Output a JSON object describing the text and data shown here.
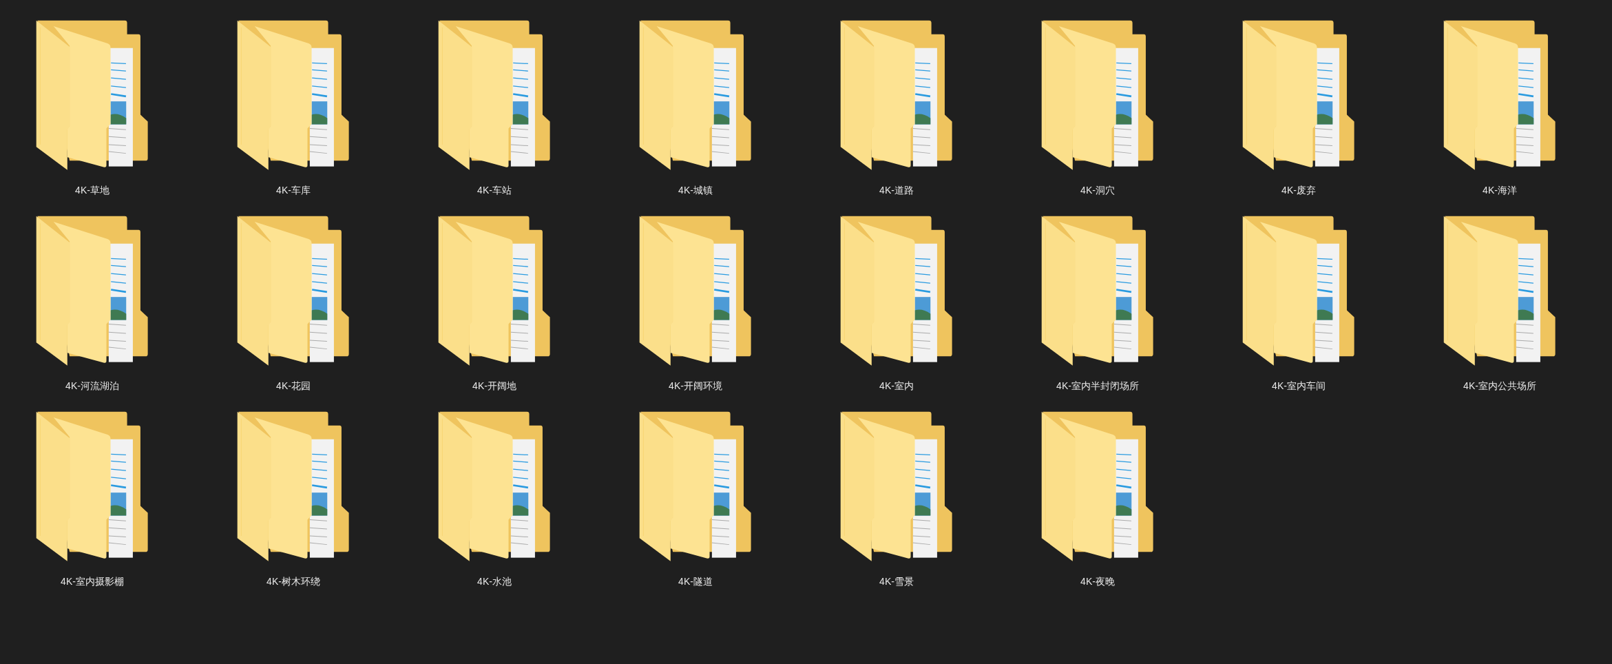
{
  "folders": [
    {
      "label": "4K-草地"
    },
    {
      "label": "4K-车库"
    },
    {
      "label": "4K-车站"
    },
    {
      "label": "4K-城镇"
    },
    {
      "label": "4K-道路"
    },
    {
      "label": "4K-洞穴"
    },
    {
      "label": "4K-废弃"
    },
    {
      "label": "4K-海洋"
    },
    {
      "label": "4K-河流湖泊"
    },
    {
      "label": "4K-花园"
    },
    {
      "label": "4K-开阔地"
    },
    {
      "label": "4K-开阔环境"
    },
    {
      "label": "4K-室内"
    },
    {
      "label": "4K-室内半封闭场所"
    },
    {
      "label": "4K-室内车间"
    },
    {
      "label": "4K-室内公共场所"
    },
    {
      "label": "4K-室内摄影棚"
    },
    {
      "label": "4K-树木环绕"
    },
    {
      "label": "4K-水池"
    },
    {
      "label": "4K-隧道"
    },
    {
      "label": "4K-雪景"
    },
    {
      "label": "4K-夜晚"
    }
  ]
}
